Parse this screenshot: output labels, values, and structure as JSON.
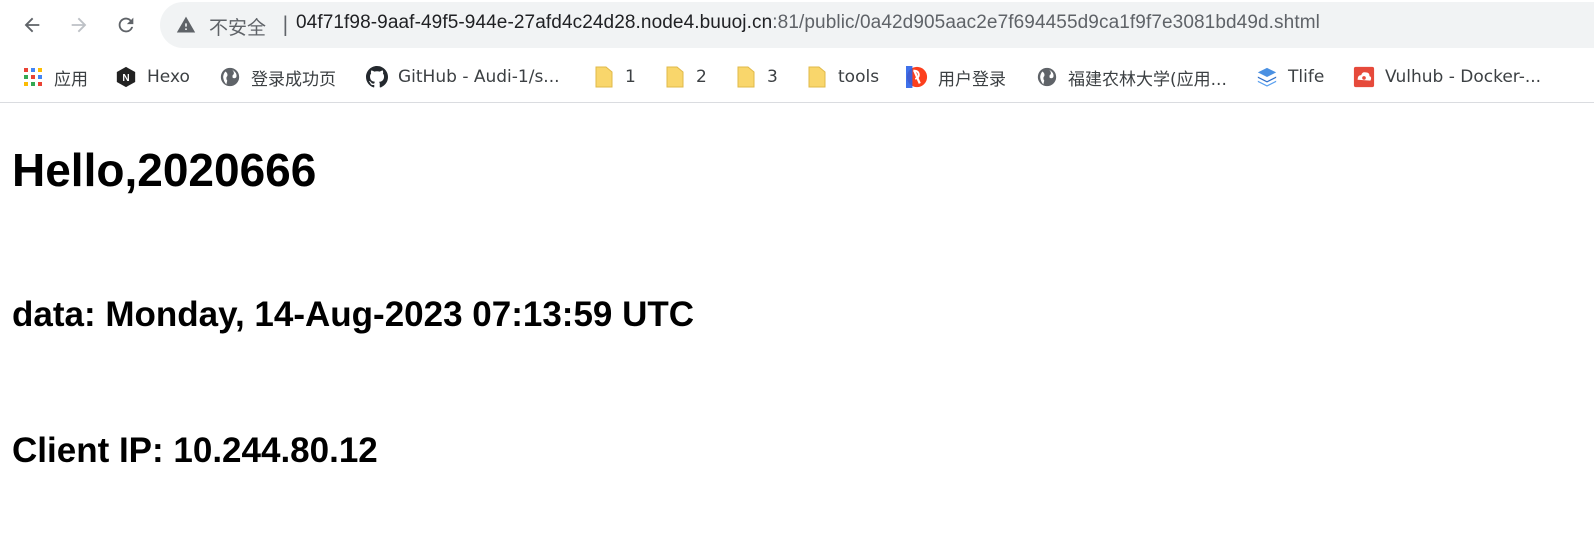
{
  "browser": {
    "security_label": "不安全",
    "separator": "|",
    "url_host": "04f71f98-9aaf-49f5-944e-27afd4c24d28.node4.buuoj.cn",
    "url_path": ":81/public/0a42d905aac2e7f694455d9ca1f9f7e3081bd49d.shtml",
    "icons": {
      "back": "back-arrow-icon",
      "forward": "forward-arrow-icon",
      "reload": "reload-icon",
      "warning": "warning-triangle-icon"
    }
  },
  "bookmarks": [
    {
      "label": "应用",
      "icon": "apps-grid-icon"
    },
    {
      "label": "Hexo",
      "icon": "hexo-icon"
    },
    {
      "label": "登录成功页",
      "icon": "globe-icon"
    },
    {
      "label": "GitHub - Audi-1/s...",
      "icon": "github-icon"
    },
    {
      "label": "1",
      "icon": "folder-icon"
    },
    {
      "label": "2",
      "icon": "folder-icon"
    },
    {
      "label": "3",
      "icon": "folder-icon"
    },
    {
      "label": "tools",
      "icon": "folder-icon"
    },
    {
      "label": "用户登录",
      "icon": "yandex-icon"
    },
    {
      "label": "福建农林大学(应用...",
      "icon": "globe-icon"
    },
    {
      "label": "Tlife",
      "icon": "layers-icon"
    },
    {
      "label": "Vulhub - Docker-...",
      "icon": "vulhub-icon"
    }
  ],
  "page": {
    "heading": "Hello,2020666",
    "date_line": "data: Monday, 14-Aug-2023 07:13:59 UTC",
    "ip_line": "Client IP: 10.244.80.12"
  },
  "colors": {
    "omnibox_bg": "#f1f3f4",
    "folder_yellow": "#f9d66b",
    "text_dark": "#202124",
    "text_muted": "#5f6368"
  }
}
